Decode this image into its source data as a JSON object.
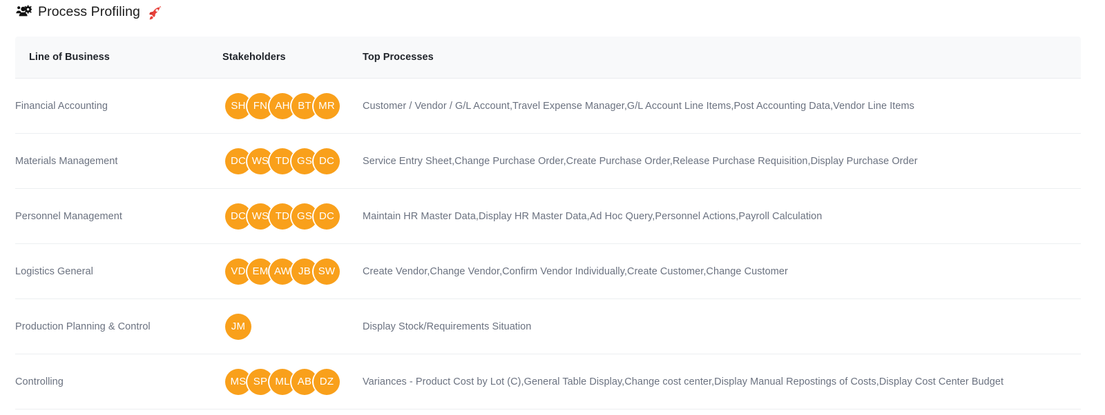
{
  "header": {
    "title": "Process Profiling",
    "icon": "users-gear-icon",
    "emoji": "rocket-icon",
    "emoji_char": "🚀"
  },
  "table": {
    "columns": [
      "Line of Business",
      "Stakeholders",
      "Top Processes"
    ],
    "rows": [
      {
        "line_of_business": "Financial Accounting",
        "stakeholders": [
          "SH",
          "FN",
          "AH",
          "BT",
          "MR"
        ],
        "top_processes": "Customer / Vendor / G/L Account,Travel Expense Manager,G/L Account Line Items,Post Accounting Data,Vendor Line Items"
      },
      {
        "line_of_business": "Materials Management",
        "stakeholders": [
          "DC",
          "WS",
          "TD",
          "GS",
          "DC"
        ],
        "top_processes": "Service Entry Sheet,Change Purchase Order,Create Purchase Order,Release Purchase Requisition,Display Purchase Order"
      },
      {
        "line_of_business": "Personnel Management",
        "stakeholders": [
          "DC",
          "WS",
          "TD",
          "GS",
          "DC"
        ],
        "top_processes": "Maintain HR Master Data,Display HR Master Data,Ad Hoc Query,Personnel Actions,Payroll Calculation"
      },
      {
        "line_of_business": "Logistics General",
        "stakeholders": [
          "VD",
          "EM",
          "AW",
          "JB",
          "SW"
        ],
        "top_processes": "Create Vendor,Change Vendor,Confirm Vendor Individually,Create Customer,Change Customer"
      },
      {
        "line_of_business": "Production Planning & Control",
        "stakeholders": [
          "JM"
        ],
        "top_processes": "Display Stock/Requirements Situation"
      },
      {
        "line_of_business": "Controlling",
        "stakeholders": [
          "MS",
          "SP",
          "ML",
          "AB",
          "DZ"
        ],
        "top_processes": "Variances - Product Cost by Lot (C),General Table Display,Change cost center,Display Manual Repostings of Costs,Display Cost Center Budget"
      }
    ]
  },
  "colors": {
    "avatar": "#f9a01b",
    "header_bg": "#f8f9fa",
    "text_muted": "#6b7280",
    "text_dark": "#1f2329"
  }
}
